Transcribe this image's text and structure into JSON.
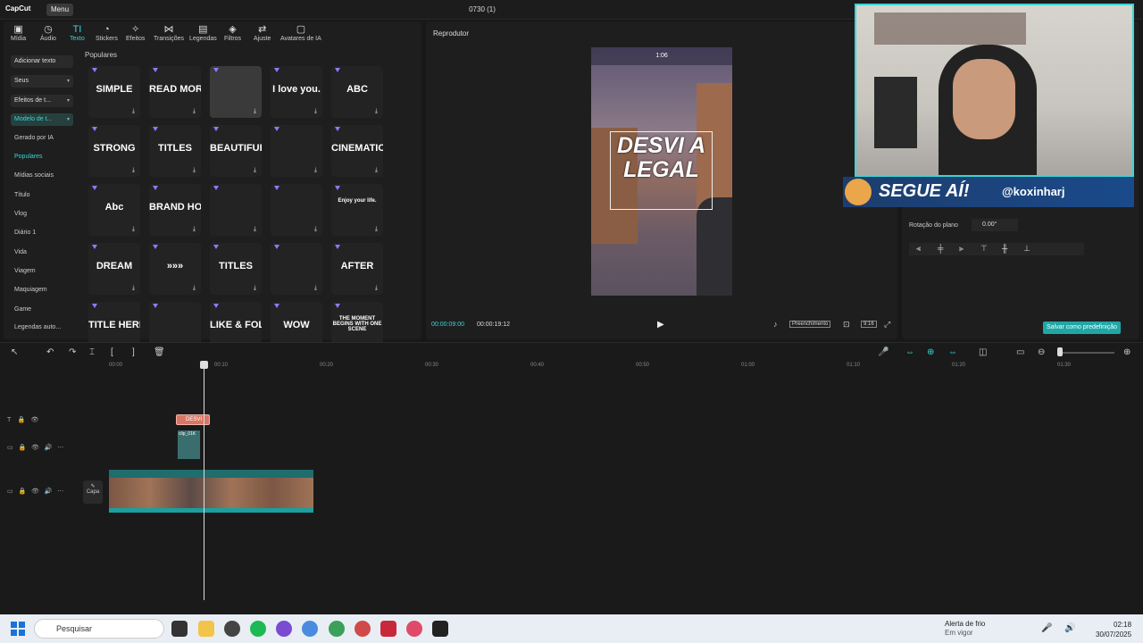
{
  "titlebar": {
    "logo": "CapCut",
    "menu": "Menu",
    "title": "0730 (1)"
  },
  "toolbar": [
    "Mídia",
    "Áudio",
    "Texto",
    "Stickers",
    "Efeitos",
    "Transições",
    "Legendas",
    "Filtros",
    "Ajuste",
    "Avatares de IA"
  ],
  "categories": {
    "add_text": "Adicionar texto",
    "yours": "Seus",
    "text_effects": "Efeitos de t...",
    "text_templates": "Modelo de t...",
    "items": [
      "Gerado por IA",
      "Populares",
      "Mídias sociais",
      "Título",
      "Vlog",
      "Diário 1",
      "Vida",
      "Viagem",
      "Maquiagem",
      "Game",
      "Legendas auto..."
    ]
  },
  "section_label": "Populares",
  "tiles": [
    "SIMPLE",
    "READ MORE >",
    "",
    "I love you.",
    "ABC",
    "STRONG",
    "TITLES",
    "BEAUTIFUL DAY",
    "",
    "CINEMATIC",
    "Abc",
    "BRAND HOODIE",
    "",
    "",
    "Enjoy your life.",
    "DREAM",
    "»»»",
    "TITLES",
    "",
    "AFTER",
    "TITLE HERE",
    "",
    "LIKE & FOLLOW",
    "WOW",
    "THE MOMENT BEGINS WITH ONE SCENE"
  ],
  "player": {
    "title": "Reprodutor",
    "hud_time": "1:06",
    "overlay_text": "DESVI A LEGAL",
    "time_current": "00:00:09:00",
    "time_total": "00:00:19:12",
    "fill_label": "Preenchimento",
    "ratio_label": "9:16"
  },
  "right_panel": {
    "rotation_label": "Rotação do plano",
    "rotation_value": "0.00°",
    "save_button": "Salvar como predefinição"
  },
  "webcam_banner": {
    "text": "SEGUE AÍ!",
    "handle": "@koxinharj"
  },
  "timeline": {
    "ticks": [
      "00:00",
      "00:10",
      "00:20",
      "00:30",
      "00:40",
      "00:50",
      "01:00",
      "01:10",
      "01:20",
      "01:30"
    ],
    "text_clip": "DESVI",
    "small_clip": "clip_01K",
    "main_clip_labels": [
      "clip",
      "clip_01K1BANTZ0QSMA7661Z6",
      "clip_01K1BANTZ0QSMA7661Z6",
      "clip"
    ],
    "cover_label": "Capa"
  },
  "taskbar": {
    "search": "Pesquisar",
    "weather_title": "Alerta de frio",
    "weather_sub": "Em vigor",
    "time": "02:18",
    "date": "30/07/2025",
    "badge": "6"
  }
}
